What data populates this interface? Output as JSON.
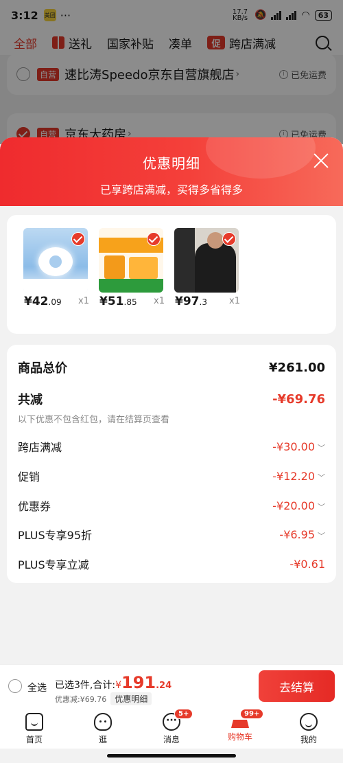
{
  "status_bar": {
    "time": "3:12",
    "app_badge": "美团",
    "more": "···",
    "net_speed": "17.7 KB/s",
    "battery": "63"
  },
  "tabs": [
    {
      "label": "全部",
      "active": true
    },
    {
      "label": "送礼",
      "active": false
    },
    {
      "label": "国家补贴",
      "active": false
    },
    {
      "label": "凑单",
      "active": false
    },
    {
      "label": "跨店满减",
      "active": false,
      "badge": "促"
    }
  ],
  "stores": [
    {
      "self_tag": "自营",
      "name": "速比涛Speedo京东自营旗舰店",
      "shipping": "已免运费",
      "checked": false
    },
    {
      "self_tag": "自营",
      "name": "京东大药房",
      "shipping": "已免运费",
      "checked": true
    }
  ],
  "sheet": {
    "title": "优惠明细",
    "subtitle": "已享跨店满减，买得多省得多"
  },
  "products": [
    {
      "price_int": "¥42",
      "price_dec": ".09",
      "qty": "x1"
    },
    {
      "price_int": "¥51",
      "price_dec": ".85",
      "qty": "x1"
    },
    {
      "price_int": "¥97",
      "price_dec": ".3",
      "qty": "x1"
    }
  ],
  "summary": {
    "total_label": "商品总价",
    "total_value": "¥261.00",
    "reduce_label": "共减",
    "reduce_value": "-¥69.76",
    "note": "以下优惠不包含红包，请在结算页查看",
    "lines": [
      {
        "label": "跨店满减",
        "value": "-¥30.00",
        "expand": true
      },
      {
        "label": "促销",
        "value": "-¥12.20",
        "expand": true
      },
      {
        "label": "优惠券",
        "value": "-¥20.00",
        "expand": true
      },
      {
        "label": "PLUS专享95折",
        "value": "-¥6.95",
        "expand": true
      },
      {
        "label": "PLUS专享立减",
        "value": "-¥0.61",
        "expand": false
      }
    ]
  },
  "checkout": {
    "select_all": "全选",
    "selected_text": "已选3件,合计:",
    "currency": "¥",
    "amount_int": "191",
    "amount_dec": ".24",
    "discount_text": "优惠减:¥69.76",
    "detail_chip": "优惠明细",
    "pay_button": "去结算"
  },
  "nav": [
    {
      "label": "首页",
      "icon": "home-icon"
    },
    {
      "label": "逛",
      "icon": "browse-icon"
    },
    {
      "label": "消息",
      "icon": "message-icon",
      "badge": "5+"
    },
    {
      "label": "购物车",
      "icon": "cart-icon",
      "badge": "99+",
      "active": true
    },
    {
      "label": "我的",
      "icon": "profile-icon"
    }
  ]
}
